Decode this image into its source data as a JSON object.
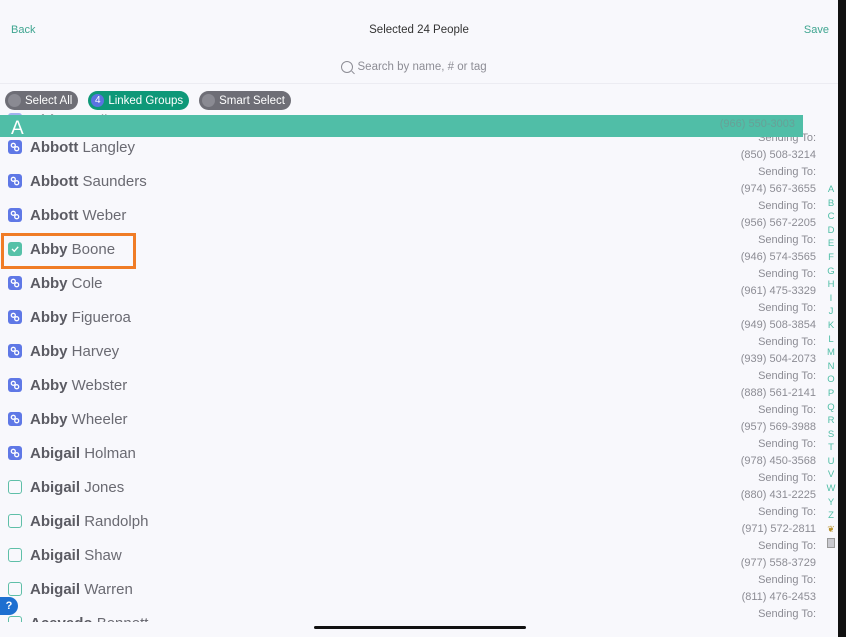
{
  "nav": {
    "back_label": "Back",
    "title": "Selected 24 People",
    "save_label": "Save"
  },
  "search": {
    "placeholder": "Search by name, # or tag"
  },
  "filters": [
    {
      "label": "Select All",
      "style": "gray"
    },
    {
      "label": "Linked Groups",
      "badge": "4",
      "style": "green"
    },
    {
      "label": "Smart Select",
      "style": "gray"
    }
  ],
  "section": {
    "letter": "A",
    "hidden_row_first": "Abbott",
    "hidden_row_last": "Kelly",
    "hidden_row_phone": "(966) 550-3003"
  },
  "sending_label": "Sending To:",
  "rows": [
    {
      "first": "Abbott",
      "last": "Langley",
      "phone": "(850) 508-3214",
      "state": "linked"
    },
    {
      "first": "Abbott",
      "last": "Saunders",
      "phone": "(974) 567-3655",
      "state": "linked"
    },
    {
      "first": "Abbott",
      "last": "Weber",
      "phone": "(956) 567-2205",
      "state": "linked"
    },
    {
      "first": "Abby",
      "last": "Boone",
      "phone": "(946) 574-3565",
      "state": "checked"
    },
    {
      "first": "Abby",
      "last": "Cole",
      "phone": "(961) 475-3329",
      "state": "linked"
    },
    {
      "first": "Abby",
      "last": "Figueroa",
      "phone": "(949) 508-3854",
      "state": "linked"
    },
    {
      "first": "Abby",
      "last": "Harvey",
      "phone": "(939) 504-2073",
      "state": "linked"
    },
    {
      "first": "Abby",
      "last": "Webster",
      "phone": "(888) 561-2141",
      "state": "linked"
    },
    {
      "first": "Abby",
      "last": "Wheeler",
      "phone": "(957) 569-3988",
      "state": "linked"
    },
    {
      "first": "Abigail",
      "last": "Holman",
      "phone": "(978) 450-3568",
      "state": "linked"
    },
    {
      "first": "Abigail",
      "last": "Jones",
      "phone": "(880) 431-2225",
      "state": "empty"
    },
    {
      "first": "Abigail",
      "last": "Randolph",
      "phone": "(971) 572-2811",
      "state": "empty"
    },
    {
      "first": "Abigail",
      "last": "Shaw",
      "phone": "(977) 558-3729",
      "state": "empty"
    },
    {
      "first": "Abigail",
      "last": "Warren",
      "phone": "(811) 476-2453",
      "state": "empty"
    },
    {
      "first": "Acevedo",
      "last": "Bennett",
      "phone": "",
      "state": "empty"
    }
  ],
  "index_letters": [
    "A",
    "B",
    "C",
    "D",
    "E",
    "F",
    "G",
    "H",
    "I",
    "J",
    "K",
    "L",
    "M",
    "N",
    "O",
    "P",
    "Q",
    "R",
    "S",
    "T",
    "U",
    "V",
    "W",
    "Y",
    "Z"
  ],
  "index_extras": [
    "emoji-icon",
    "trash-icon"
  ],
  "help_label": "?",
  "colors": {
    "accent": "#3fa590",
    "section": "#50bea7",
    "linked": "#5f78e6",
    "highlight": "#f07c26",
    "chip_green": "#0e9878"
  }
}
